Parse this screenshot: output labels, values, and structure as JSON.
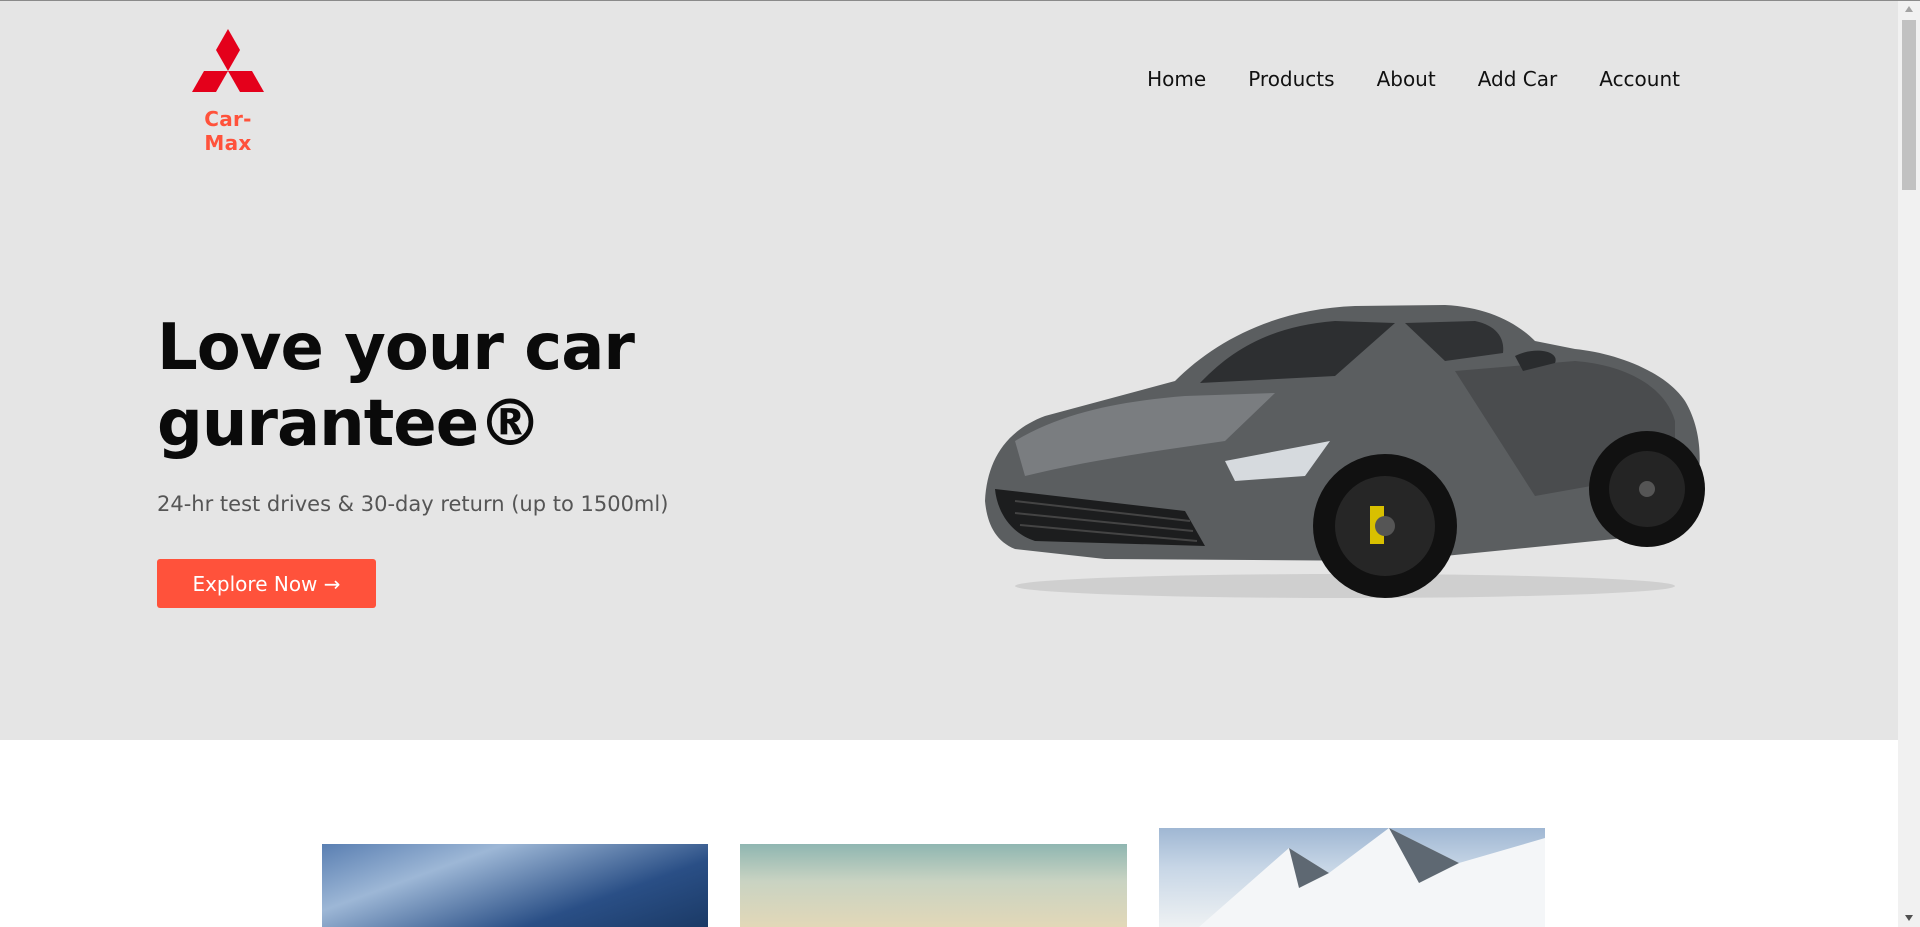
{
  "brand": {
    "name": "Car-Max",
    "accent_color": "#ff523b",
    "logo_color": "#e4001b"
  },
  "nav": {
    "items": [
      {
        "label": "Home"
      },
      {
        "label": "Products"
      },
      {
        "label": "About"
      },
      {
        "label": "Add Car"
      },
      {
        "label": "Account"
      }
    ]
  },
  "hero": {
    "headline_line1": "Love your car",
    "headline_line2": "gurantee®",
    "subtitle": "24-hr test drives & 30-day return (up to 1500ml)",
    "cta_label": "Explore Now →",
    "background": "#e5e5e5"
  },
  "gallery": {
    "cards": [
      {
        "icon": "car-tunnel-image"
      },
      {
        "icon": "car-dome-image"
      },
      {
        "icon": "snowy-mountain-image"
      }
    ]
  }
}
